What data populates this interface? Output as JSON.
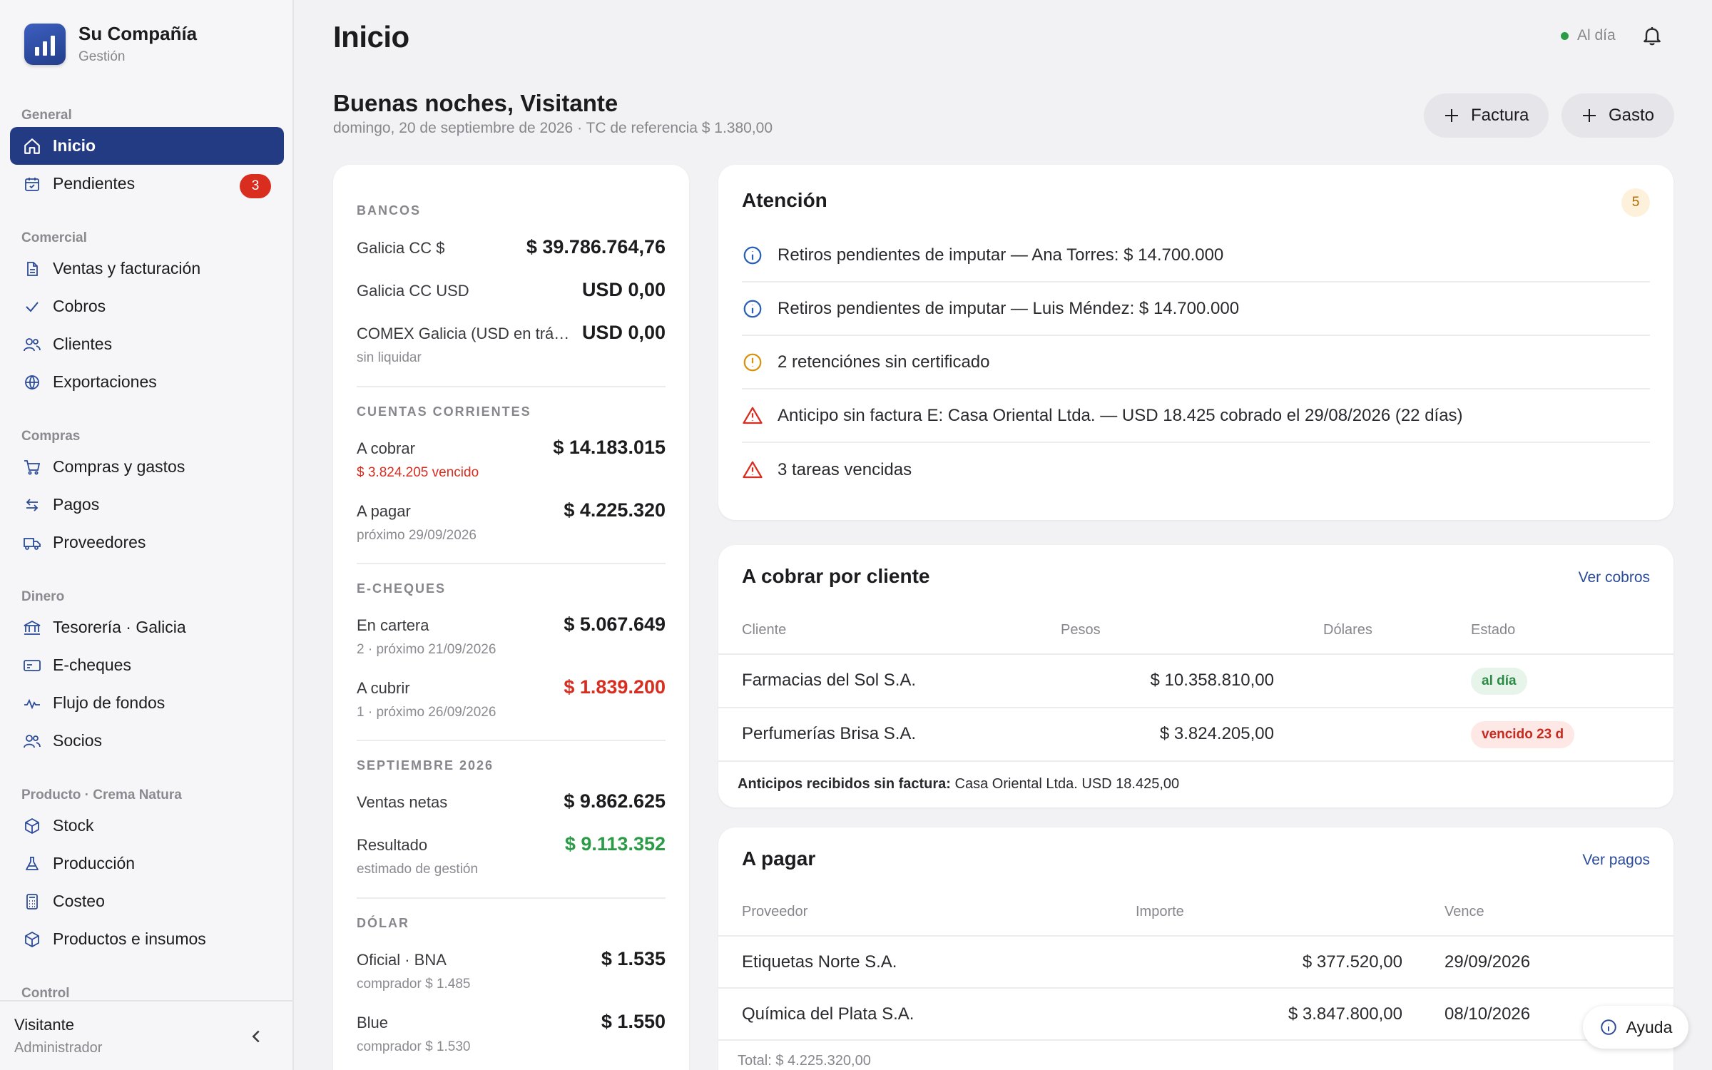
{
  "brand": {
    "name": "Su Compañía",
    "subtitle": "Gestión"
  },
  "sidebar": {
    "sections": [
      {
        "title": "General",
        "items": [
          {
            "label": "Inicio",
            "icon": "home-icon",
            "active": true
          },
          {
            "label": "Pendientes",
            "icon": "calendar-check-icon",
            "badge": "3"
          }
        ]
      },
      {
        "title": "Comercial",
        "items": [
          {
            "label": "Ventas y facturación",
            "icon": "document-icon"
          },
          {
            "label": "Cobros",
            "icon": "check-icon"
          },
          {
            "label": "Clientes",
            "icon": "users-icon"
          },
          {
            "label": "Exportaciones",
            "icon": "globe-icon"
          }
        ]
      },
      {
        "title": "Compras",
        "items": [
          {
            "label": "Compras y gastos",
            "icon": "cart-icon"
          },
          {
            "label": "Pagos",
            "icon": "transfer-icon"
          },
          {
            "label": "Proveedores",
            "icon": "truck-icon"
          }
        ]
      },
      {
        "title": "Dinero",
        "items": [
          {
            "label": "Tesorería · Galicia",
            "icon": "bank-icon"
          },
          {
            "label": "E-cheques",
            "icon": "cheque-icon"
          },
          {
            "label": "Flujo de fondos",
            "icon": "pulse-icon"
          },
          {
            "label": "Socios",
            "icon": "users-icon"
          }
        ]
      },
      {
        "title": "Producto · Crema Natura",
        "items": [
          {
            "label": "Stock",
            "icon": "box-icon"
          },
          {
            "label": "Producción",
            "icon": "flask-icon"
          },
          {
            "label": "Costeo",
            "icon": "calculator-icon"
          },
          {
            "label": "Productos e insumos",
            "icon": "box-icon"
          }
        ]
      },
      {
        "title": "Control",
        "items": []
      }
    ],
    "user": {
      "name": "Visitante",
      "role": "Administrador"
    }
  },
  "header": {
    "title": "Inicio",
    "status": "Al día",
    "status_color": "#2c9b48",
    "greeting": "Buenas noches, Visitante",
    "subline": "domingo, 20 de septiembre de 2026 · TC de referencia $ 1.380,00",
    "btn_factura": "Factura",
    "btn_gasto": "Gasto"
  },
  "summary": {
    "bancos": {
      "title": "BANCOS",
      "rows": [
        {
          "label": "Galicia CC $",
          "value": "$ 39.786.764,76"
        },
        {
          "label": "Galicia CC USD",
          "value": "USD 0,00"
        },
        {
          "label": "COMEX Galicia (USD en trá…",
          "sub": "sin liquidar",
          "value": "USD 0,00"
        }
      ]
    },
    "cuentas": {
      "title": "CUENTAS CORRIENTES",
      "rows": [
        {
          "label": "A cobrar",
          "sub": "$ 3.824.205 vencido",
          "value": "$ 14.183.015"
        },
        {
          "label": "A pagar",
          "sub": "próximo 29/09/2026",
          "value": "$ 4.225.320"
        }
      ]
    },
    "echeques": {
      "title": "E-CHEQUES",
      "rows": [
        {
          "label": "En cartera",
          "sub": "2 · próximo 21/09/2026",
          "value": "$ 5.067.649"
        },
        {
          "label": "A cubrir",
          "sub": "1 · próximo 26/09/2026",
          "value": "$ 1.839.200"
        }
      ]
    },
    "mes": {
      "title": "SEPTIEMBRE 2026",
      "rows": [
        {
          "label": "Ventas netas",
          "value": "$ 9.862.625"
        },
        {
          "label": "Resultado",
          "sub": "estimado de gestión",
          "value": "$ 9.113.352"
        }
      ]
    },
    "dolar": {
      "title": "DÓLAR",
      "rows": [
        {
          "label": "Oficial · BNA",
          "sub": "comprador $ 1.485",
          "value": "$ 1.535"
        },
        {
          "label": "Blue",
          "sub": "comprador $ 1.530",
          "value": "$ 1.550"
        }
      ]
    }
  },
  "attention": {
    "title": "Atención",
    "count": "5",
    "items": [
      {
        "level": "info",
        "text": "Retiros pendientes de imputar — Ana Torres: $ 14.700.000"
      },
      {
        "level": "info",
        "text": "Retiros pendientes de imputar — Luis Méndez: $ 14.700.000"
      },
      {
        "level": "warning",
        "text": "2 retenciónes sin certificado"
      },
      {
        "level": "danger",
        "text": "Anticipo sin factura E: Casa Oriental Ltda. — USD 18.425 cobrado el 29/08/2026 (22 días)"
      },
      {
        "level": "danger",
        "text": "3 tareas vencidas"
      }
    ],
    "colors": {
      "info": "#2a5fb8",
      "warning": "#d9920f",
      "danger": "#d92d20"
    }
  },
  "receivables": {
    "title": "A cobrar por cliente",
    "link": "Ver cobros",
    "columns": [
      "Cliente",
      "Pesos",
      "Dólares",
      "Estado"
    ],
    "rows": [
      {
        "client": "Farmacias del Sol S.A.",
        "pesos": "$ 10.358.810,00",
        "dolares": "",
        "estado": "al día",
        "kind": "ok"
      },
      {
        "client": "Perfumerías Brisa S.A.",
        "pesos": "$ 3.824.205,00",
        "dolares": "",
        "estado": "vencido 23 d",
        "kind": "bad"
      }
    ],
    "footer_label": "Anticipos recibidos sin factura:",
    "footer_value": "Casa Oriental Ltda. USD 18.425,00"
  },
  "payables": {
    "title": "A pagar",
    "link": "Ver pagos",
    "columns": [
      "Proveedor",
      "Importe",
      "Vence"
    ],
    "rows": [
      {
        "supplier": "Etiquetas Norte S.A.",
        "amount": "$ 377.520,00",
        "due": "29/09/2026"
      },
      {
        "supplier": "Química del Plata S.A.",
        "amount": "$ 3.847.800,00",
        "due": "08/10/2026"
      }
    ],
    "total": "Total: $ 4.225.320,00"
  },
  "help": {
    "label": "Ayuda"
  }
}
